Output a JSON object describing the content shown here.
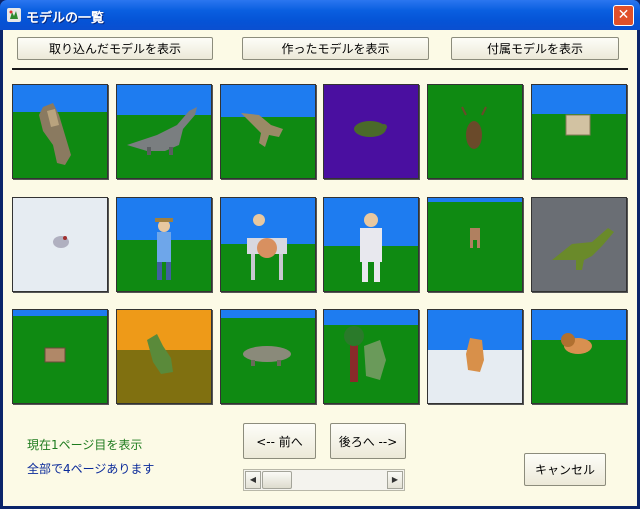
{
  "window": {
    "title": "モデルの一覧",
    "close_label": "✕"
  },
  "toolbar": {
    "imported_label": "取り込んだモデルを表示",
    "created_label": "作ったモデルを表示",
    "bundled_label": "付属モデルを表示"
  },
  "models": [
    {
      "figure": "standing-dinosaur",
      "sky": "#1e7cf0",
      "ground": "#0f8a12"
    },
    {
      "figure": "long-neck-dinosaur",
      "sky": "#1e7cf0",
      "ground": "#0f8a12"
    },
    {
      "figure": "running-dinosaur",
      "sky": "#1e7cf0",
      "ground": "#0f8a12"
    },
    {
      "figure": "turtle",
      "sky": "#4a0fa0",
      "ground": "#4a0fa0"
    },
    {
      "figure": "beetle",
      "sky": "#0f8a12",
      "ground": "#0f8a12"
    },
    {
      "figure": "box",
      "sky": "#1e7cf0",
      "ground": "#0f8a12"
    },
    {
      "figure": "small-creature",
      "sky": "#e6ecf2",
      "ground": "#e6ecf2"
    },
    {
      "figure": "man-with-hat",
      "sky": "#1e7cf0",
      "ground": "#0f8a12"
    },
    {
      "figure": "man-with-horse",
      "sky": "#1e7cf0",
      "ground": "#0f8a12"
    },
    {
      "figure": "standing-man",
      "sky": "#1e7cf0",
      "ground": "#0f8a12"
    },
    {
      "figure": "small-dog",
      "sky": "#1e7cf0",
      "ground": "#0f8a12"
    },
    {
      "figure": "t-rex",
      "sky": "#6a6e74",
      "ground": "#6a6e74"
    },
    {
      "figure": "small-box",
      "sky": "#1e7cf0",
      "ground": "#0f8a12"
    },
    {
      "figure": "green-lizard",
      "sky": "#ee9a18",
      "ground": "#807010"
    },
    {
      "figure": "ankylosaur",
      "sky": "#1e7cf0",
      "ground": "#0f8a12"
    },
    {
      "figure": "tree-creature",
      "sky": "#1e7cf0",
      "ground": "#0f8a12"
    },
    {
      "figure": "sitting-dog",
      "sky": "#1e7cf0",
      "ground": "#e6ecf2"
    },
    {
      "figure": "lion",
      "sky": "#1e7cf0",
      "ground": "#0f8a12"
    }
  ],
  "status": {
    "current_page": "現在1ページ目を表示",
    "total_pages": "全部で4ページあります"
  },
  "pager": {
    "prev_label": "<-- 前へ",
    "next_label": "後ろへ -->",
    "scroll_left": "◀",
    "scroll_right": "▶"
  },
  "cancel_label": "キャンセル"
}
